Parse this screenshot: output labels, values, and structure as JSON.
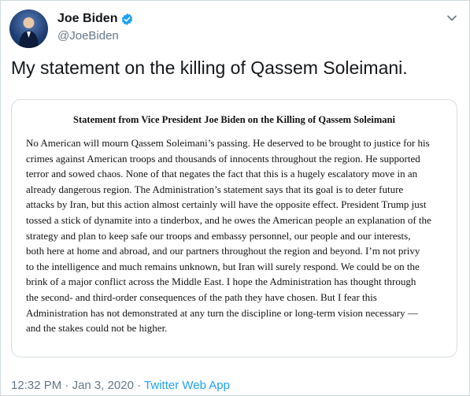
{
  "author": {
    "name": "Joe Biden",
    "handle": "@JoeBiden",
    "verified_color": "#1da1f2",
    "avatar_icon": "profile-photo"
  },
  "tweet": {
    "text": "My statement on the killing of Qassem Soleimani."
  },
  "card": {
    "title": "Statement from Vice President Joe Biden on the Killing of Qassem Soleimani",
    "lines": [
      "No American will mourn Qassem Soleimani’s passing. He deserved to be brought to justice for his",
      "crimes against American troops and thousands of innocents throughout the region. He supported",
      "terror and sowed chaos. None of that negates the fact that this is a hugely escalatory move in an",
      "already dangerous region. The Administration’s statement says that its goal is to deter future",
      "attacks by Iran, but this action almost certainly will have the opposite effect. President Trump just",
      "tossed a stick of dynamite into a tinderbox, and he owes the American people an explanation of the",
      "strategy and plan to keep safe our troops and embassy personnel, our people and our interests,",
      "both here at home and abroad, and our partners throughout the region and beyond. I’m not privy",
      "to the intelligence and much remains unknown, but Iran will surely respond. We could be on the",
      "brink of a major conflict across the Middle East. I hope the Administration has thought through",
      "the second- and third-order consequences of the path they have chosen. But I fear this",
      "Administration has not demonstrated at any turn the discipline or long-term vision necessary —",
      "and the stakes could not be higher."
    ]
  },
  "meta": {
    "time": "12:32 PM",
    "date": "Jan 3, 2020",
    "separator": "·",
    "source": "Twitter Web App"
  }
}
